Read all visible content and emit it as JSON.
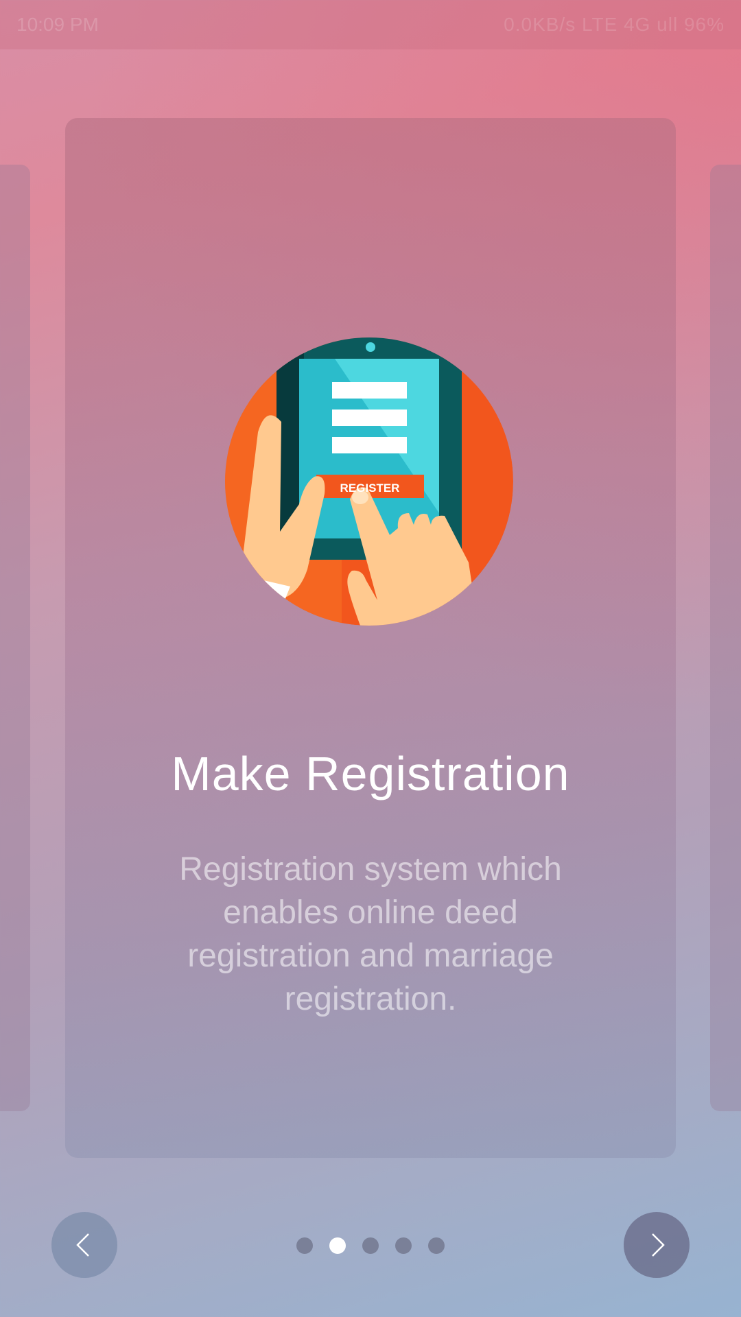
{
  "status_bar": {
    "time": "10:09 PM",
    "indicators": "0.0KB/s  LTE  4G  ull  96%"
  },
  "slide": {
    "title": "Make Registration",
    "description": "Registration system which enables online deed registration and marriage registration.",
    "illustration": {
      "button_text": "REGISTER",
      "colors": {
        "circle": "#f2561d",
        "tablet": "#0b5a5c",
        "screen": "#4dd7e0",
        "hand": "#ffc98f"
      }
    }
  },
  "pager": {
    "total": 5,
    "active_index": 1,
    "prev_icon": "chevron-left-icon",
    "next_icon": "chevron-right-icon"
  }
}
